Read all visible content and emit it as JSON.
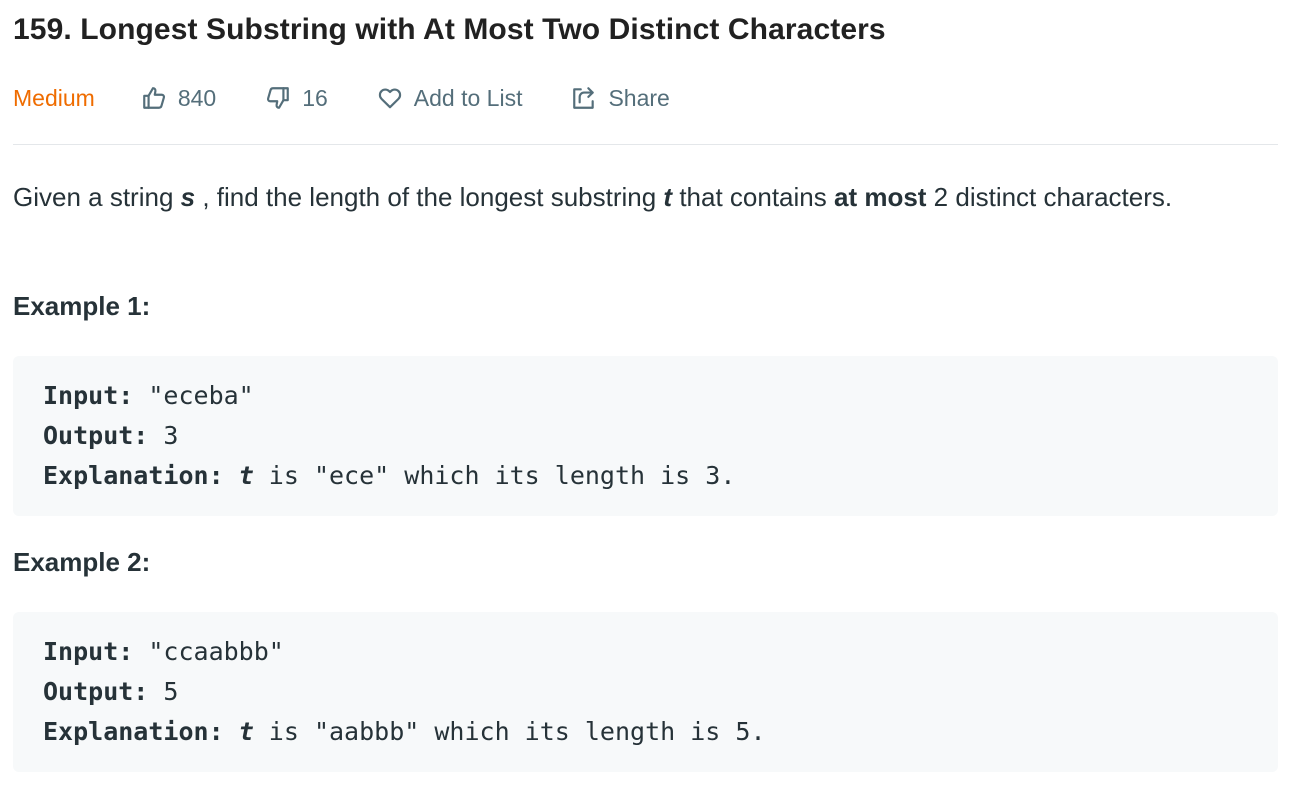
{
  "problem": {
    "title": "159. Longest Substring with At Most Two Distinct Characters",
    "difficulty": "Medium",
    "likes": "840",
    "dislikes": "16",
    "add_to_list_label": "Add to List",
    "share_label": "Share"
  },
  "colors": {
    "difficulty_medium": "#ef6c00",
    "text": "#263238",
    "muted": "#546e7a",
    "code_bg": "#f7f9fa"
  },
  "icons": {
    "like": "thumbs-up-icon",
    "dislike": "thumbs-down-icon",
    "add_to_list": "heart-icon",
    "share": "share-icon"
  },
  "description": {
    "part1": "Given a string ",
    "var_s": "s",
    "part2": " , find the length of the longest substring ",
    "var_t": "t",
    "part3": "  that contains ",
    "emphasis": "at most",
    "part4": " 2 distinct characters."
  },
  "examples": [
    {
      "heading": "Example 1:",
      "input_label": "Input:",
      "input_value": " \"eceba\"",
      "output_label": "Output:",
      "output_value": " 3",
      "explanation_label": "Explanation:",
      "explanation_var": "t",
      "explanation_text": " is \"ece\" which its length is 3."
    },
    {
      "heading": "Example 2:",
      "input_label": "Input:",
      "input_value": " \"ccaabbb\"",
      "output_label": "Output:",
      "output_value": " 5",
      "explanation_label": "Explanation:",
      "explanation_var": "t",
      "explanation_text": " is \"aabbb\" which its length is 5."
    }
  ]
}
